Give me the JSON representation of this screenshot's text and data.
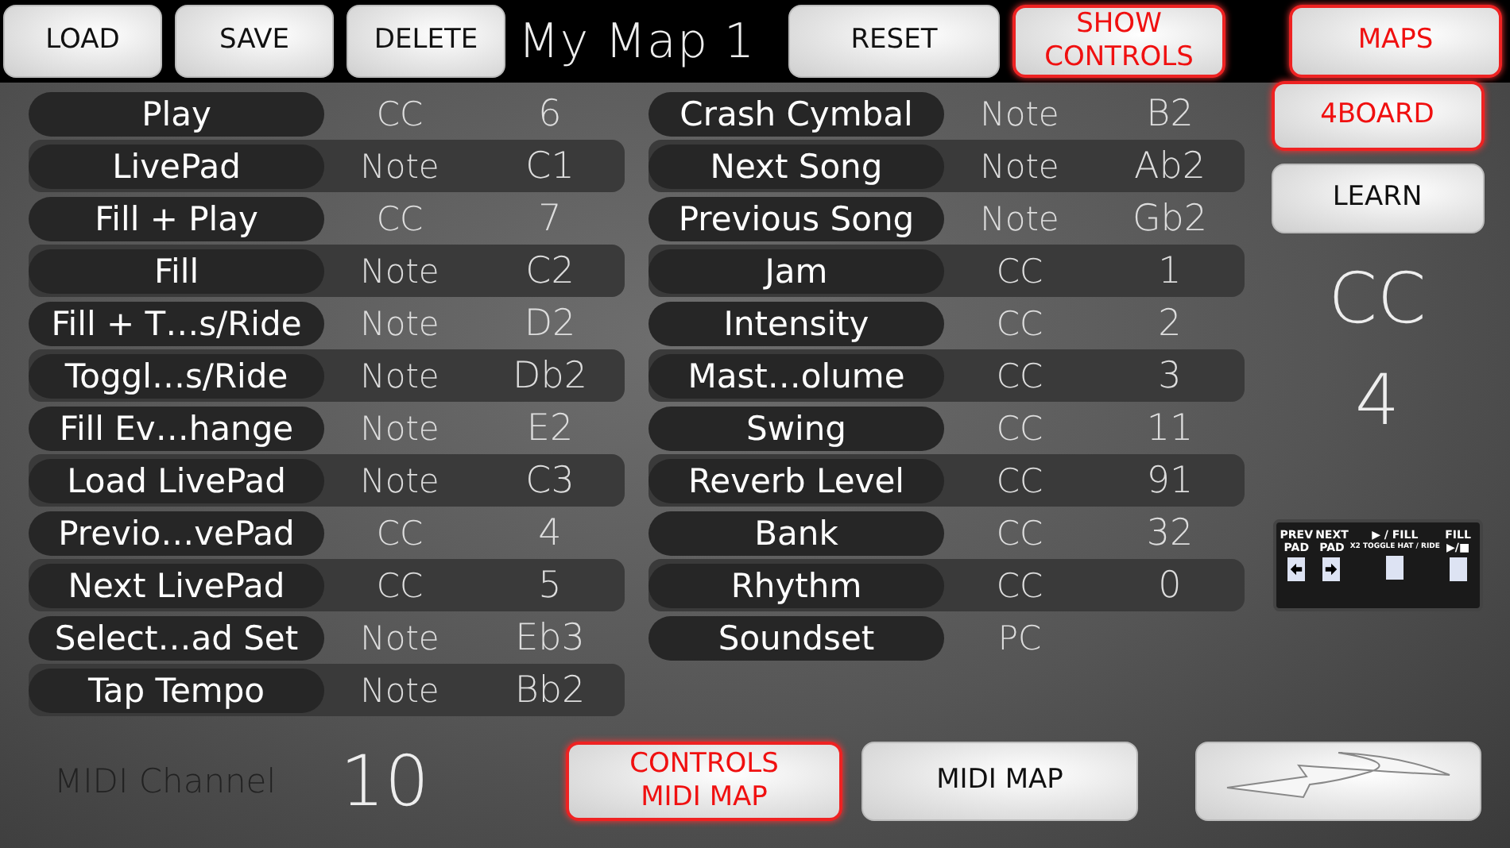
{
  "toolbar": {
    "buttons": [
      {
        "label": "LOAD",
        "active": false
      },
      {
        "label": "SAVE",
        "active": false
      },
      {
        "label": "DELETE",
        "active": false
      }
    ],
    "map_name": "My Map 1",
    "right_buttons": [
      {
        "label": "RESET",
        "active": false
      },
      {
        "label": "SHOW CONTROLS",
        "active": true
      }
    ],
    "maps_button": {
      "label": "MAPS",
      "active": true
    }
  },
  "mappings": [
    {
      "name": "Play",
      "type": "CC",
      "value": "6"
    },
    {
      "name": "LivePad",
      "type": "Note",
      "value": "C1"
    },
    {
      "name": "Fill + Play",
      "type": "CC",
      "value": "7"
    },
    {
      "name": "Fill",
      "type": "Note",
      "value": "C2"
    },
    {
      "name": "Fill + T…s/Ride",
      "type": "Note",
      "value": "D2"
    },
    {
      "name": "Toggl…s/Ride",
      "type": "Note",
      "value": "Db2"
    },
    {
      "name": "Fill Ev…hange",
      "type": "Note",
      "value": "E2"
    },
    {
      "name": "Load LivePad",
      "type": "Note",
      "value": "C3"
    },
    {
      "name": "Previo…vePad",
      "type": "CC",
      "value": "4"
    },
    {
      "name": "Next LivePad",
      "type": "CC",
      "value": "5"
    },
    {
      "name": "Select…ad Set",
      "type": "Note",
      "value": "Eb3"
    },
    {
      "name": "Tap Tempo",
      "type": "Note",
      "value": "Bb2"
    },
    {
      "name": "Crash Cymbal",
      "type": "Note",
      "value": "B2"
    },
    {
      "name": "Next Song",
      "type": "Note",
      "value": "Ab2"
    },
    {
      "name": "Previous Song",
      "type": "Note",
      "value": "Gb2"
    },
    {
      "name": "Jam",
      "type": "CC",
      "value": "1"
    },
    {
      "name": "Intensity",
      "type": "CC",
      "value": "2"
    },
    {
      "name": "Mast…olume",
      "type": "CC",
      "value": "3"
    },
    {
      "name": "Swing",
      "type": "CC",
      "value": "11"
    },
    {
      "name": "Reverb Level",
      "type": "CC",
      "value": "91"
    },
    {
      "name": "Bank",
      "type": "CC",
      "value": "32"
    },
    {
      "name": "Rhythm",
      "type": "CC",
      "value": "0"
    },
    {
      "name": "Soundset",
      "type": "PC"
    }
  ],
  "sidebar": {
    "buttons": [
      {
        "label": "4BOARD",
        "active": true
      },
      {
        "label": "LEARN",
        "active": false
      }
    ],
    "learn_type": "CC",
    "learn_value": "4",
    "pedal": [
      {
        "label": "PREV PAD",
        "kind": "left"
      },
      {
        "label": "NEXT PAD",
        "kind": "right"
      },
      {
        "label": "▶ / FILL",
        "sub": "X2 TOGGLE HAT / RIDE",
        "kind": "blank"
      },
      {
        "label": "FILL ▶/■",
        "kind": "blank"
      }
    ]
  },
  "bottom": {
    "channel_label": "MIDI Channel",
    "channel_value": "10",
    "buttons": [
      {
        "label": "CONTROLS MIDI MAP",
        "active": true
      },
      {
        "label": "MIDI MAP",
        "active": false
      }
    ]
  }
}
